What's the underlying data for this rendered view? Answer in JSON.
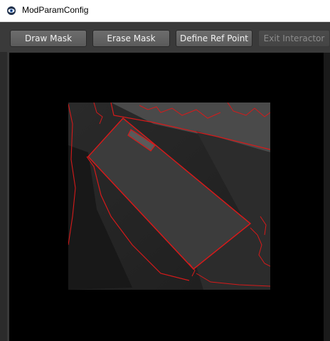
{
  "window": {
    "title": "ModParamConfig",
    "icon": "eye-app-icon"
  },
  "toolbar": {
    "buttons": [
      {
        "label": "Draw Mask",
        "enabled": true
      },
      {
        "label": "Erase Mask",
        "enabled": true
      },
      {
        "label": "Define Ref Point",
        "enabled": true
      },
      {
        "label": "Exit Interactor",
        "enabled": false
      }
    ]
  },
  "colors": {
    "accent_contour": "#d61a1a",
    "background": "#000000",
    "toolbar": "#3a3a3a"
  }
}
